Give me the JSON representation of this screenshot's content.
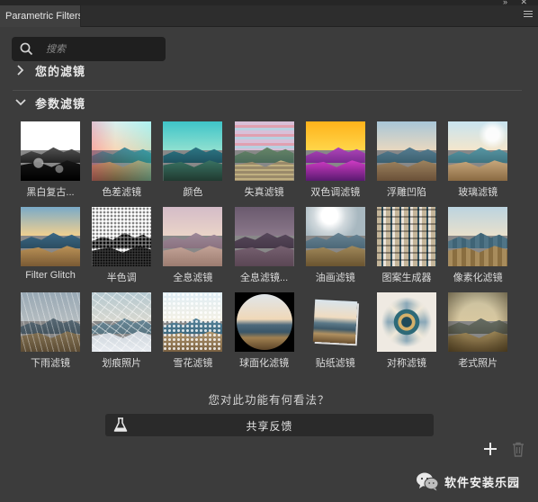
{
  "panel": {
    "tab_title": "Parametric Filters"
  },
  "search": {
    "placeholder": "搜索",
    "value": ""
  },
  "sections": {
    "yours": {
      "label": "您的滤镜",
      "state": "collapsed"
    },
    "parametric": {
      "label": "参数滤镜",
      "state": "expanded"
    }
  },
  "filters": [
    {
      "label": "黑白复古...",
      "style": "bw"
    },
    {
      "label": "色差滤镜",
      "style": "chromatic"
    },
    {
      "label": "颜色",
      "style": "color"
    },
    {
      "label": "失真滤镜",
      "style": "distort"
    },
    {
      "label": "双色调滤镜",
      "style": "duotone"
    },
    {
      "label": "浮雕凹陷",
      "style": "emboss"
    },
    {
      "label": "玻璃滤镜",
      "style": "glass"
    },
    {
      "label": "Filter Glitch",
      "style": "glitch"
    },
    {
      "label": "半色调",
      "style": "halftone"
    },
    {
      "label": "全息滤镜",
      "style": "holo"
    },
    {
      "label": "全息滤镜...",
      "style": "holo2"
    },
    {
      "label": "油画滤镜",
      "style": "oil"
    },
    {
      "label": "图案生成器",
      "style": "pattern"
    },
    {
      "label": "像素化滤镜",
      "style": "pixel"
    },
    {
      "label": "下雨滤镜",
      "style": "rain"
    },
    {
      "label": "划痕照片",
      "style": "scratch"
    },
    {
      "label": "雪花滤镜",
      "style": "snow"
    },
    {
      "label": "球面化滤镜",
      "style": "sphere"
    },
    {
      "label": "贴纸滤镜",
      "style": "sticker"
    },
    {
      "label": "对称滤镜",
      "style": "symmetry"
    },
    {
      "label": "老式照片",
      "style": "vintage"
    }
  ],
  "feedback": {
    "question": "您对此功能有何看法？",
    "button_label": "共享反馈"
  },
  "footer": {
    "add_icon": "plus-icon",
    "delete_icon": "trash-icon"
  },
  "watermark": {
    "label": "软件安装乐园"
  }
}
